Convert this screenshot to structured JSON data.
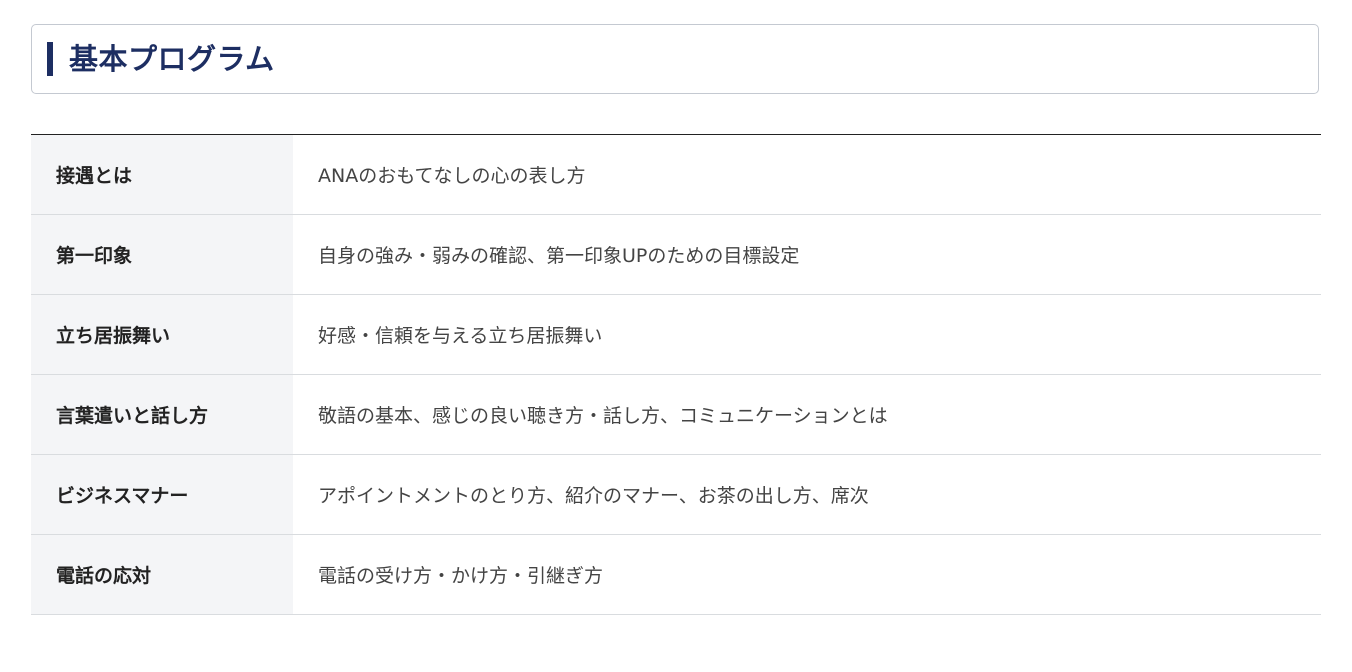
{
  "header": {
    "title": "基本プログラム"
  },
  "program": {
    "rows": [
      {
        "label": "接遇とは",
        "description": "ANAのおもてなしの心の表し方"
      },
      {
        "label": "第一印象",
        "description": "自身の強み・弱みの確認、第一印象UPのための目標設定"
      },
      {
        "label": "立ち居振舞い",
        "description": "好感・信頼を与える立ち居振舞い"
      },
      {
        "label": "言葉遣いと話し方",
        "description": "敬語の基本、感じの良い聴き方・話し方、コミュニケーションとは"
      },
      {
        "label": "ビジネスマナー",
        "description": "アポイントメントのとり方、紹介のマナー、お茶の出し方、席次"
      },
      {
        "label": "電話の応対",
        "description": "電話の受け方・かけ方・引継ぎ方"
      }
    ]
  },
  "colors": {
    "accent": "#1d2e62",
    "label_background": "#f4f5f7",
    "row_border": "#d9dcdf"
  }
}
